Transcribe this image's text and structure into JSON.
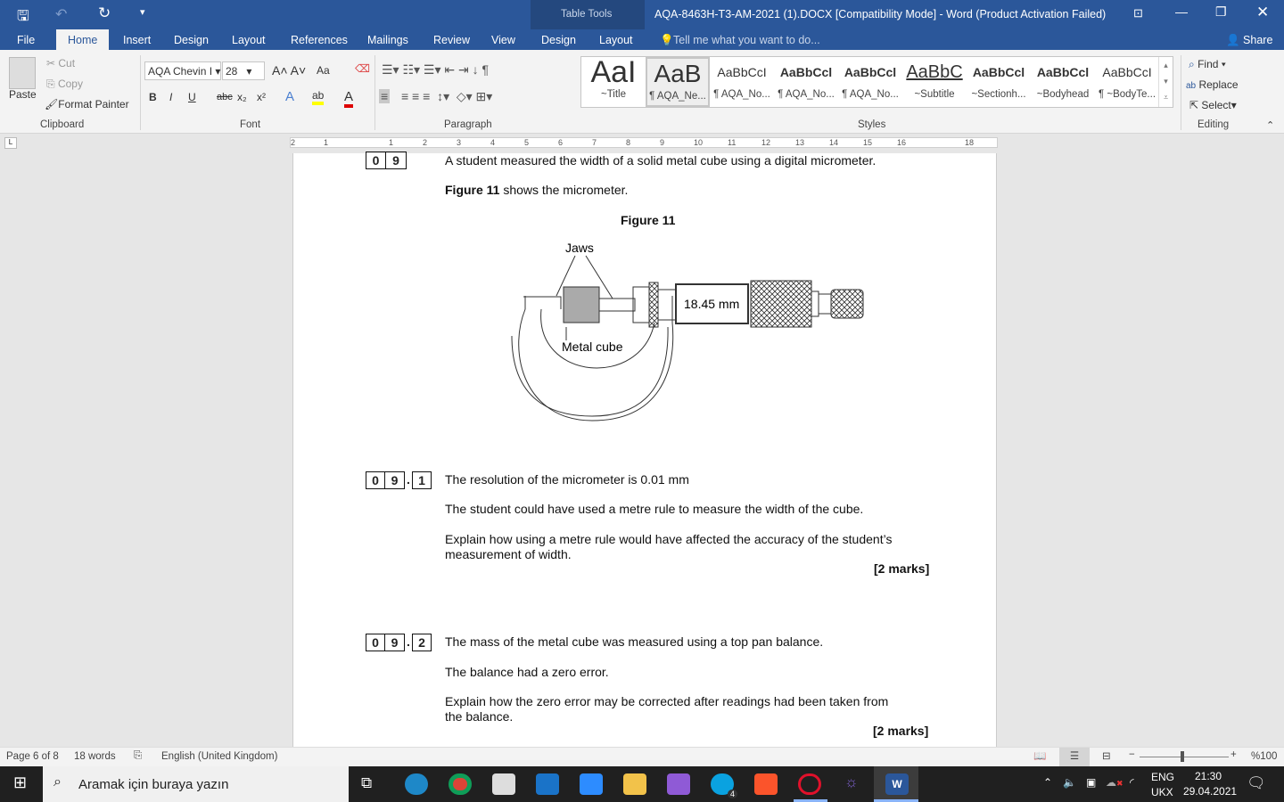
{
  "titlebar": {
    "table_tools": "Table Tools",
    "title": "AQA-8463H-T3-AM-2021 (1).DOCX [Compatibility Mode] - Word (Product Activation Failed)"
  },
  "tabs": [
    "File",
    "Home",
    "Insert",
    "Design",
    "Layout",
    "References",
    "Mailings",
    "Review",
    "View",
    "Design",
    "Layout"
  ],
  "tell_me": "Tell me what you want to do...",
  "share": "Share",
  "clipboard": {
    "paste": "Paste",
    "cut": "Cut",
    "copy": "Copy",
    "format_painter": "Format Painter",
    "label": "Clipboard"
  },
  "font": {
    "name": "AQA Chevin I",
    "size": "28",
    "label": "Font",
    "case": "Aa"
  },
  "paragraph": {
    "label": "Paragraph"
  },
  "styles": {
    "label": "Styles",
    "items": [
      {
        "preview": "AaI",
        "name": "~Title"
      },
      {
        "preview": "AaB",
        "name": "¶ AQA_Ne..."
      },
      {
        "preview": "AaBbCcI",
        "name": "¶ AQA_No..."
      },
      {
        "preview": "AaBbCcl",
        "name": "¶ AQA_No..."
      },
      {
        "preview": "AaBbCcl",
        "name": "¶ AQA_No..."
      },
      {
        "preview": "AaBbC",
        "name": "~Subtitle"
      },
      {
        "preview": "AaBbCcl",
        "name": "~Sectionh..."
      },
      {
        "preview": "AaBbCcl",
        "name": "~Bodyhead"
      },
      {
        "preview": "AaBbCcI",
        "name": "¶ ~BodyTe..."
      }
    ]
  },
  "editing": {
    "find": "Find",
    "replace": "Replace",
    "select": "Select",
    "label": "Editing"
  },
  "ruler": [
    "2",
    "1",
    "1",
    "2",
    "3",
    "4",
    "5",
    "6",
    "7",
    "8",
    "9",
    "10",
    "11",
    "12",
    "13",
    "14",
    "15",
    "16",
    "18"
  ],
  "doc": {
    "q_top": [
      "0",
      "9"
    ],
    "line1": "A student measured the width of a solid metal cube using a digital micrometer.",
    "fig_ref_bold": "Figure 11",
    "fig_ref_rest": " shows the micrometer.",
    "fig_title": "Figure 11",
    "fig_labels": {
      "jaws": "Jaws",
      "reading": "18.45 mm",
      "cube": "Metal cube"
    },
    "q1": [
      "0",
      "9",
      "1"
    ],
    "q1_l1": "The resolution of the micrometer is 0.01 mm",
    "q1_l2": "The student could have used a metre rule to measure the width of the cube.",
    "q1_l3": "Explain how using a metre rule would have affected the accuracy of the student’s",
    "q1_l4": "measurement of width.",
    "marks": "[2 marks]",
    "q2": [
      "0",
      "9",
      "2"
    ],
    "q2_l1": "The mass of the metal cube was measured using a top pan balance.",
    "q2_l2": "The balance had a zero error.",
    "q2_l3": "Explain how the zero error may be corrected after readings had been taken from",
    "q2_l4": "the balance."
  },
  "status": {
    "page": "Page 6 of 8",
    "words": "18 words",
    "language": "English (United Kingdom)",
    "zoom": "%100"
  },
  "taskbar": {
    "search": "Aramak için buraya yazın",
    "lang1": "ENG",
    "lang2": "UKX",
    "time": "21:30",
    "date": "29.04.2021",
    "skype_badge": "4"
  }
}
